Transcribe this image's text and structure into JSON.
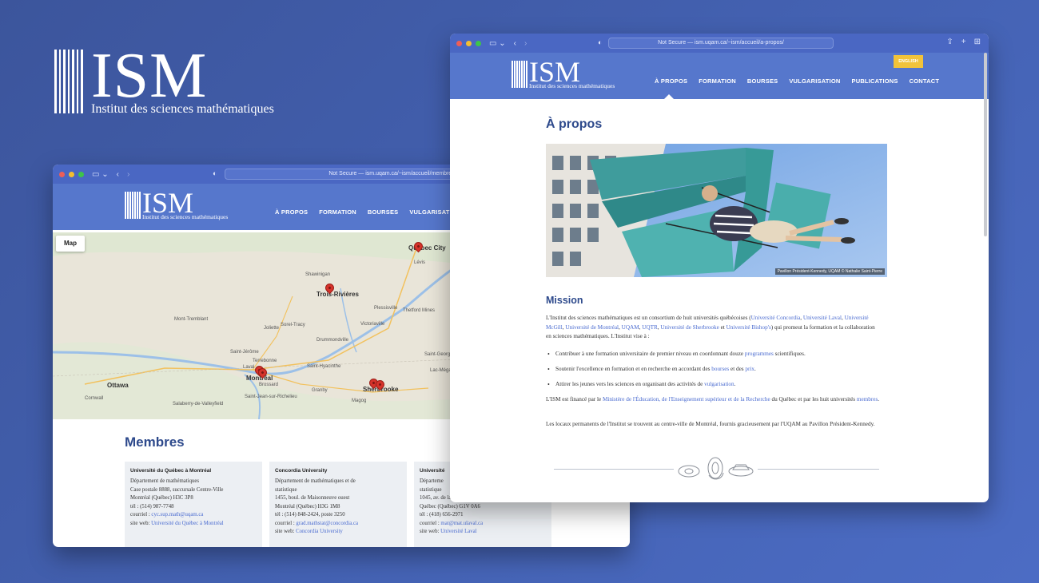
{
  "brand": {
    "logo_text": "ISM",
    "subtitle": "Institut des sciences mathématiques"
  },
  "back_window": {
    "url": "Not Secure — ism.uqam.ca/~ism/accueil/membres/",
    "nav": [
      "À PROPOS",
      "FORMATION",
      "BOURSES",
      "VULGARISATION"
    ],
    "map": {
      "button_label": "Map",
      "places": [
        {
          "name": "Québec City",
          "major": true
        },
        {
          "name": "Trois-Rivières",
          "major": true
        },
        {
          "name": "Montréal",
          "major": true
        },
        {
          "name": "Ottawa",
          "major": true
        },
        {
          "name": "Sherbrooke",
          "major": true
        },
        {
          "name": "Shawinigan",
          "major": false
        },
        {
          "name": "Drummondville",
          "major": false
        },
        {
          "name": "Victoriaville",
          "major": false
        },
        {
          "name": "Saint-Jérôme",
          "major": false
        },
        {
          "name": "Terrebonne",
          "major": false
        },
        {
          "name": "Laval",
          "major": false
        },
        {
          "name": "Granby",
          "major": false
        },
        {
          "name": "Saint-Jean-sur-Richelieu",
          "major": false
        },
        {
          "name": "Sorel-Tracy",
          "major": false
        },
        {
          "name": "Joliette",
          "major": false
        },
        {
          "name": "Lévis",
          "major": false
        },
        {
          "name": "Magog",
          "major": false
        },
        {
          "name": "Salaberry-de-Valleyfield",
          "major": false
        },
        {
          "name": "Mont-Tremblant",
          "major": false
        },
        {
          "name": "Saint-Georges",
          "major": false
        },
        {
          "name": "Lac-Mégantic",
          "major": false
        },
        {
          "name": "Thetford Mines",
          "major": false
        },
        {
          "name": "Plessisville",
          "major": false
        },
        {
          "name": "Cornwall",
          "major": false
        },
        {
          "name": "Brossard",
          "major": false
        },
        {
          "name": "Saint-Hyacinthe",
          "major": false
        }
      ]
    },
    "membres_title": "Membres",
    "members": [
      {
        "name": "Université du Québec à Montréal",
        "lines": [
          "Département de mathématiques",
          "Case postale 8888, succursale Centre-Ville",
          "Montréal (Québec) H3C 3P8",
          "tél : (514) 987-7748"
        ],
        "email_label": "courriel : ",
        "email": "cyc.sup.math@uqam.ca",
        "site_label": "site web: ",
        "site": "Université du Québec à Montréal"
      },
      {
        "name": "Concordia University",
        "lines": [
          "Département de mathématiques et de",
          "statistique",
          "1455, boul. de Maisonneuve ouest",
          "Montréal (Québec) H3G 1M8",
          "tél : (514) 848-2424, poste 3250"
        ],
        "email_label": "courriel : ",
        "email": "grad.mathstat@concordia.ca",
        "site_label": "site web: ",
        "site": "Concordia University"
      },
      {
        "name": "Université",
        "lines": [
          "Départeme",
          "statistique",
          "1045, av. de la Médecine",
          "Québec (Québec) G1V 0A6",
          "tél : (418) 656-2971"
        ],
        "email_label": "courriel : ",
        "email": "mat@mat.ulaval.ca",
        "site_label": "site web: ",
        "site": "Université Laval"
      }
    ]
  },
  "front_window": {
    "url": "Not Secure — ism.uqam.ca/~ism/accueil/a-propos/",
    "english_label": "ENGLISH",
    "nav": [
      "À PROPOS",
      "FORMATION",
      "BOURSES",
      "VULGARISATION",
      "PUBLICATIONS",
      "CONTACT"
    ],
    "page_title": "À propos",
    "hero_caption": "Pavillon Président-Kennedy, UQAM © Nathalie Saint-Pierre",
    "mission_title": "Mission",
    "mission_intro_1": "L'Institut des sciences mathématiques est un consortium de huit universités québécoises (",
    "universities": [
      "Université Concordia",
      "Université Laval",
      "Université McGill",
      "Université de Montréal",
      "UQAM",
      "UQTR",
      "Université de Sherbrooke",
      "Université Bishop's"
    ],
    "mission_intro_2": ") qui promeut la formation et la collaboration en sciences mathématiques. L'Institut vise à :",
    "bullets": [
      {
        "before": "Contribuer à une formation universitaire de premier niveau en coordonnant douze ",
        "link": "programmes",
        "after": " scientifiques."
      },
      {
        "before": "Soutenir l'excellence en formation et en recherche en accordant des ",
        "link": "bourses",
        "middle": " et des ",
        "link2": "prix",
        "after": "."
      },
      {
        "before": "Attirer les jeunes vers les sciences en organisant des activités de ",
        "link": "vulgarisation",
        "after": "."
      }
    ],
    "funding_before": "L'ISM est financé par le ",
    "funding_link": "Ministère de l'Éducation, de l'Enseignement supérieur et de la Recherche",
    "funding_middle": " du Québec et par les huit universités ",
    "funding_link2": "membres",
    "funding_after": ".",
    "locaux": "Les locaux permanents de l'Institut se trouvent au centre-ville de Montréal, fournis gracieusement par l'UQAM au Pavillon Président-Kennedy."
  },
  "colors": {
    "background": "#4462b3",
    "header": "#5677cc",
    "accent_yellow": "#f2c33a",
    "heading": "#2e4a8c",
    "link": "#4a6bd0"
  }
}
